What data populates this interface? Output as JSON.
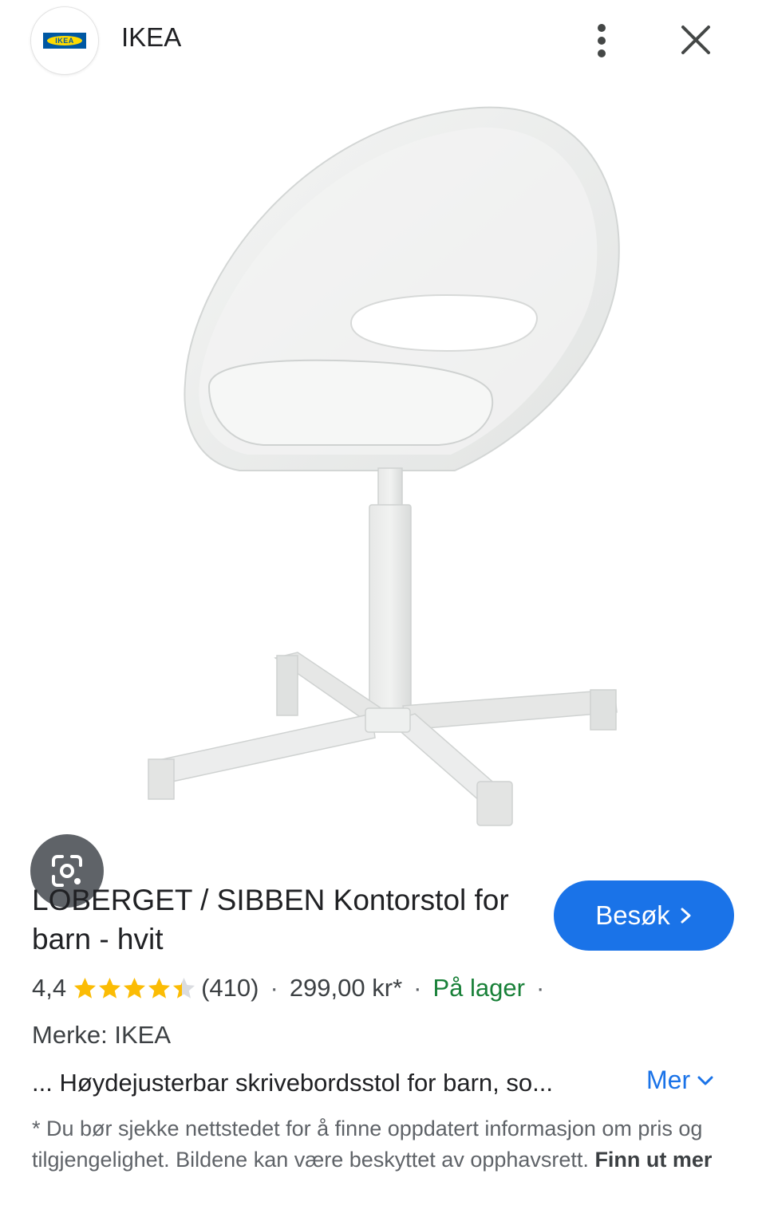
{
  "header": {
    "site_name": "IKEA",
    "logo_text": "IKEA",
    "more_icon": "more-vert-icon",
    "close_icon": "close-icon"
  },
  "image": {
    "lens_icon": "google-lens-icon"
  },
  "product": {
    "title": "LOBERGET / SIBBEN Kontorstol for barn - hvit",
    "rating": "4,4",
    "rating_value": 4.4,
    "review_count": "(410)",
    "price": "299,00 kr*",
    "stock": "På lager",
    "brand": "Merke: IKEA",
    "snippet": "... Høydejusterbar skrivebordsstol for barn, so...",
    "more_label": "Mer",
    "visit_label": "Besøk"
  },
  "disclaimer": {
    "text": "* Du bør sjekke nettstedet for å finne oppdatert informasjon om pris og tilgjengelighet. Bildene kan være beskyttet av opphavsrett.",
    "link": "Finn ut mer"
  },
  "colors": {
    "accent": "#1a73e8",
    "stock_green": "#188038",
    "star": "#fbbc04"
  }
}
